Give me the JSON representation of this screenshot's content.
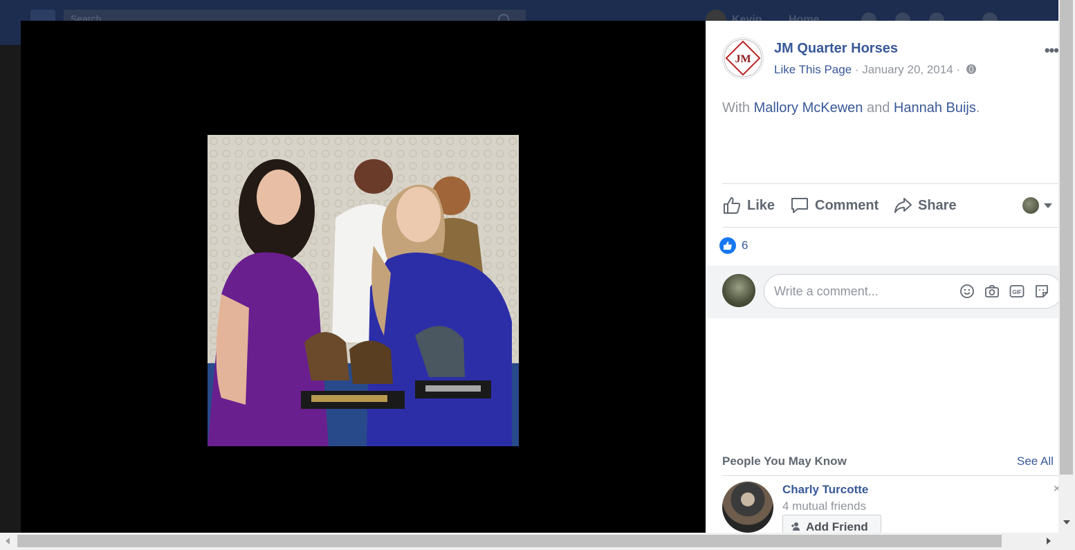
{
  "background_header": {
    "search_placeholder": "Search",
    "user_name": "Kevin",
    "home_label": "Home"
  },
  "post": {
    "page_name": "JM Quarter Horses",
    "like_page": "Like This Page",
    "separator": "·",
    "date": "January 20, 2014",
    "with_prefix": "With",
    "tagged": [
      "Mallory McKewen",
      "Hannah Buijs"
    ],
    "and_word": "and",
    "period": ".",
    "logo_text": "JM",
    "photo_alt": "Two women in purple and blue dresses holding horse trophies"
  },
  "actions": {
    "like": "Like",
    "comment": "Comment",
    "share": "Share"
  },
  "reactions": {
    "count": "6"
  },
  "comment_box": {
    "placeholder": "Write a comment..."
  },
  "pymk": {
    "title": "People You May Know",
    "see_all": "See All",
    "person": {
      "name": "Charly Turcotte",
      "mutual": "4 mutual friends",
      "add_friend": "Add Friend"
    }
  },
  "colors": {
    "link": "#385898",
    "secondary": "#90949c",
    "like_blue": "#1877f2",
    "header": "#1d2d4f"
  }
}
